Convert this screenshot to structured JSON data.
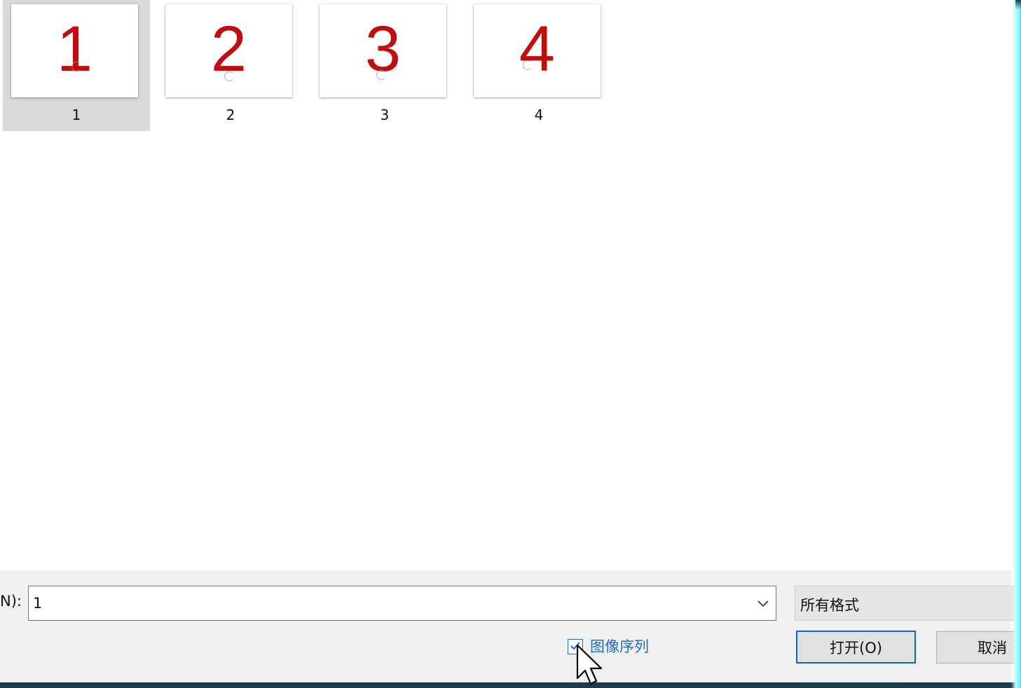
{
  "files": [
    {
      "name": "1",
      "thumbnail_text": "1",
      "selected": true
    },
    {
      "name": "2",
      "thumbnail_text": "2",
      "selected": false
    },
    {
      "name": "3",
      "thumbnail_text": "3",
      "selected": false
    },
    {
      "name": "4",
      "thumbnail_text": "4",
      "selected": false
    }
  ],
  "filename_field": {
    "label": "N):",
    "value": "1"
  },
  "filetype": {
    "selected": "所有格式"
  },
  "image_sequence": {
    "label": "图像序列",
    "checked": true
  },
  "buttons": {
    "open_label": "打开(O)",
    "cancel_label": "取消"
  },
  "icons": {
    "dropdown": "chevron-down-icon",
    "checkmark": "checkmark-icon",
    "cursor": "mouse-pointer-icon"
  },
  "colors": {
    "thumbnail_digit": "#c00d0d",
    "selection_bg": "#d9d9d9",
    "panel_bg": "#f0f0f0",
    "focus_blue": "#0a64c8",
    "link_blue": "#1c6cc0"
  }
}
